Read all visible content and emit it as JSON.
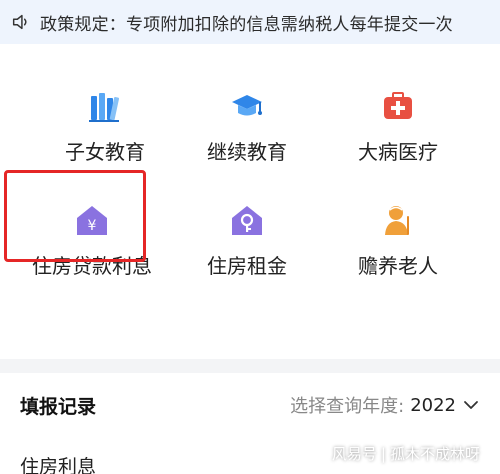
{
  "notice": {
    "icon": "speaker-icon",
    "text": "政策规定：专项附加扣除的信息需纳税人每年提交一次"
  },
  "items": [
    {
      "label": "子女教育",
      "icon": "books-icon"
    },
    {
      "label": "继续教育",
      "icon": "graduation-cap-icon"
    },
    {
      "label": "大病医疗",
      "icon": "medical-kit-icon"
    },
    {
      "label": "住房贷款利息",
      "icon": "house-yen-icon",
      "selected": true
    },
    {
      "label": "住房租金",
      "icon": "house-key-icon"
    },
    {
      "label": "赡养老人",
      "icon": "elderly-person-icon"
    }
  ],
  "records": {
    "title": "填报记录",
    "year_label": "选择查询年度:",
    "year_value": "2022",
    "first_row_partial": "住房利息"
  },
  "watermark": {
    "source": "风易号",
    "author": "孤木不成林呀"
  },
  "colors": {
    "notice_bg": "#eef4fd",
    "highlight_border": "#e52626",
    "purple": "#8a72e0",
    "blue": "#2f86e8",
    "red": "#e85042",
    "orange": "#f0a03a"
  }
}
